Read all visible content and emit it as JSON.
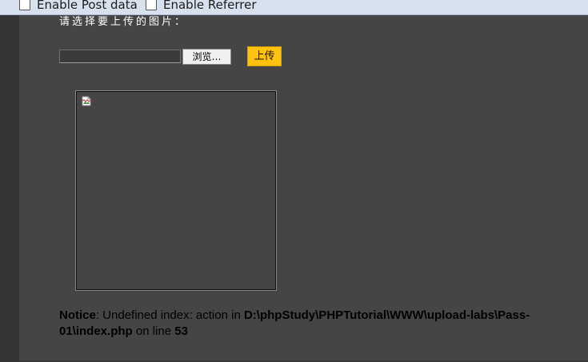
{
  "hackbar": {
    "post_data_label": "Enable Post data",
    "referrer_label": "Enable Referrer"
  },
  "upload_form": {
    "prompt": "请选择要上传的图片：",
    "browse_label": "浏览…",
    "upload_label": "上传"
  },
  "preview": {
    "icon": "broken-image-icon"
  },
  "notice": {
    "label": "Notice",
    "message": ": Undefined index: action in ",
    "path": "D:\\phpStudy\\PHPTutorial\\WWW\\upload-labs\\Pass-01\\index.php",
    "line_text": " on line ",
    "line_number": "53"
  },
  "colors": {
    "page_background": "#454545",
    "upload_button": "#ffc20e",
    "hackbar_background": "#d8e2ef"
  }
}
